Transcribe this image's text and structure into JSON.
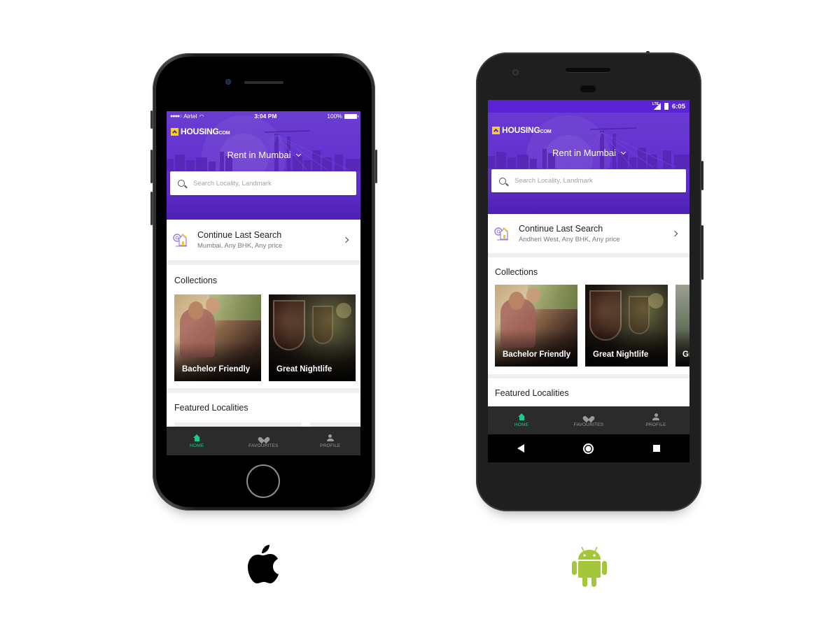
{
  "ios": {
    "status": {
      "carrier": "Airtel",
      "signal_dots": "●●●●○",
      "time": "3:04 PM",
      "battery": "100%"
    },
    "app": {
      "logo_text": "HOUSING",
      "logo_suffix": "COM",
      "city_selector": "Rent in Mumbai",
      "search_placeholder": "Search Locality, Landmark",
      "last_search": {
        "title": "Continue Last Search",
        "subtitle": "Mumbai, Any BHK, Any price"
      },
      "collections": {
        "title": "Collections",
        "items": [
          {
            "label": "Bachelor Friendly"
          },
          {
            "label": "Great Nightlife"
          }
        ]
      },
      "featured_title": "Featured Localities",
      "tabs": [
        {
          "label": "HOME",
          "icon": "home-icon",
          "active": true
        },
        {
          "label": "FAVOURITES",
          "icon": "favourites-icon",
          "active": false
        },
        {
          "label": "PROFILE",
          "icon": "profile-icon",
          "active": false
        }
      ]
    }
  },
  "android": {
    "status": {
      "network": "LTE",
      "time": "6:05"
    },
    "app": {
      "logo_text": "HOUSING",
      "logo_suffix": "COM",
      "city_selector": "Rent in Mumbai",
      "search_placeholder": "Search Locality, Landmark",
      "last_search": {
        "title": "Continue Last Search",
        "subtitle": "Andheri West, Any BHK, Any price"
      },
      "collections": {
        "title": "Collections",
        "items": [
          {
            "label": "Bachelor Friendly"
          },
          {
            "label": "Great Nightlife"
          },
          {
            "label": "Gr"
          }
        ]
      },
      "featured_title": "Featured Localities",
      "tabs": [
        {
          "label": "HOME",
          "icon": "home-icon",
          "active": true
        },
        {
          "label": "FAVOURITES",
          "icon": "favourites-icon",
          "active": false
        },
        {
          "label": "PROFILE",
          "icon": "profile-icon",
          "active": false
        }
      ]
    }
  },
  "colors": {
    "brand_purple": "#6331cf",
    "logo_yellow": "#f8d022",
    "tab_active": "#1fc98a",
    "tab_inactive": "#9a9a9a",
    "tabbar_bg": "#2b2b2b",
    "android_green": "#a4c639"
  },
  "platforms": [
    {
      "name": "Apple",
      "icon": "apple-logo-icon"
    },
    {
      "name": "Android",
      "icon": "android-logo-icon"
    }
  ]
}
